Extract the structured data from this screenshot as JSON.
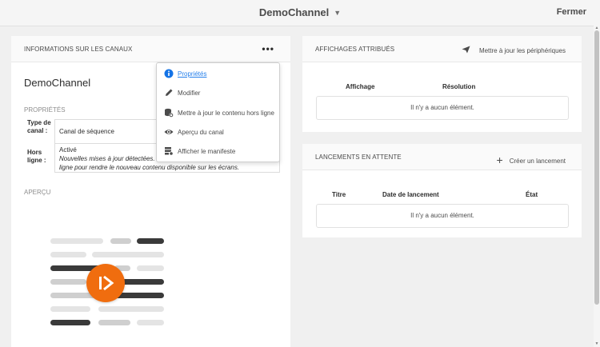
{
  "header": {
    "title": "DemoChannel",
    "title_icon": "chevron-down-icon",
    "close_label": "Fermer"
  },
  "info_card": {
    "title": "INFORMATIONS SUR LES CANAUX",
    "more_label": "•••",
    "channel_name": "DemoChannel",
    "properties_label": "PROPRIÉTÉS",
    "properties": {
      "type_key": "Type de canal :",
      "type_value": "Canal de séquence",
      "offline_key": "Hors ligne :",
      "offline_status": "Activé",
      "offline_note_line1": "Nouvelles mises à jour détectées. Util",
      "offline_note_line2": "ligne pour rendre le nouveau contenu disponible sur les écrans."
    },
    "preview_label": "APERÇU",
    "accent_color": "#f06d0f"
  },
  "actions_menu": {
    "items": [
      {
        "label": "Propriétés",
        "icon": "info-icon",
        "active": true
      },
      {
        "label": "Modifier",
        "icon": "pencil-icon",
        "active": false
      },
      {
        "label": "Mettre à jour le contenu hors ligne",
        "icon": "database-refresh-icon",
        "active": false
      },
      {
        "label": "Aperçu du canal",
        "icon": "eye-icon",
        "active": false
      },
      {
        "label": "Afficher le manifeste",
        "icon": "manifest-icon",
        "active": false
      }
    ]
  },
  "displays_card": {
    "title": "AFFICHAGES ATTRIBUÉS",
    "action_label": "Mettre à jour les périphériques",
    "action_icon": "send-icon",
    "columns": [
      "Affichage",
      "Résolution"
    ],
    "empty_text": "Il n'y a aucun élément."
  },
  "launches_card": {
    "title": "LANCEMENTS EN ATTENTE",
    "action_label": "Créer un lancement",
    "action_icon": "plus-icon",
    "columns": [
      "Titre",
      "Date de lancement",
      "État"
    ],
    "empty_text": "Il n'y a aucun élément."
  }
}
